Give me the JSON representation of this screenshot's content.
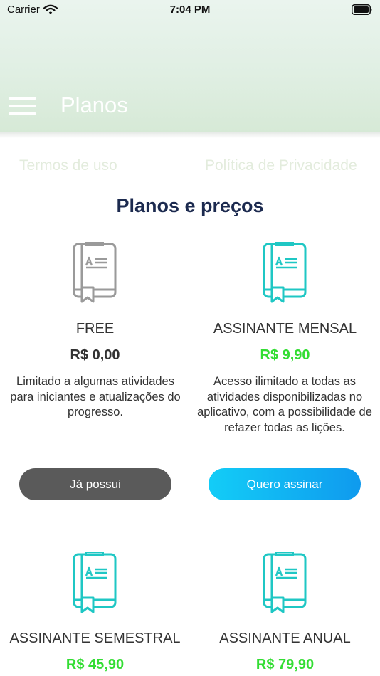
{
  "status_bar": {
    "carrier": "Carrier",
    "time": "7:04 PM"
  },
  "header": {
    "title": "Planos"
  },
  "links": {
    "terms": "Termos de uso",
    "privacy": "Política de Privacidade"
  },
  "section": {
    "title": "Planos e preços"
  },
  "colors": {
    "brand_green": "#33dd33",
    "button_cyan": "#13cdf7",
    "button_gray": "#5a5a5a",
    "title_navy": "#1c2a4f"
  },
  "plans": [
    {
      "name": "FREE",
      "price": "R$ 0,00",
      "description": "Limitado a algumas atividades para iniciantes e atualizações do progresso.",
      "button": "Já possui",
      "icon": "book-icon-gray"
    },
    {
      "name": "ASSINANTE MENSAL",
      "price": "R$ 9,90",
      "description": "Acesso ilimitado a todas as atividades disponibilizadas no aplicativo, com a possibilidade de refazer todas as lições.",
      "button": "Quero assinar",
      "icon": "book-icon-gradient"
    },
    {
      "name": "ASSINANTE SEMESTRAL",
      "price": "R$ 45,90",
      "icon": "book-icon-gradient"
    },
    {
      "name": "ASSINANTE ANUAL",
      "price": "R$ 79,90",
      "icon": "book-icon-gradient"
    }
  ]
}
